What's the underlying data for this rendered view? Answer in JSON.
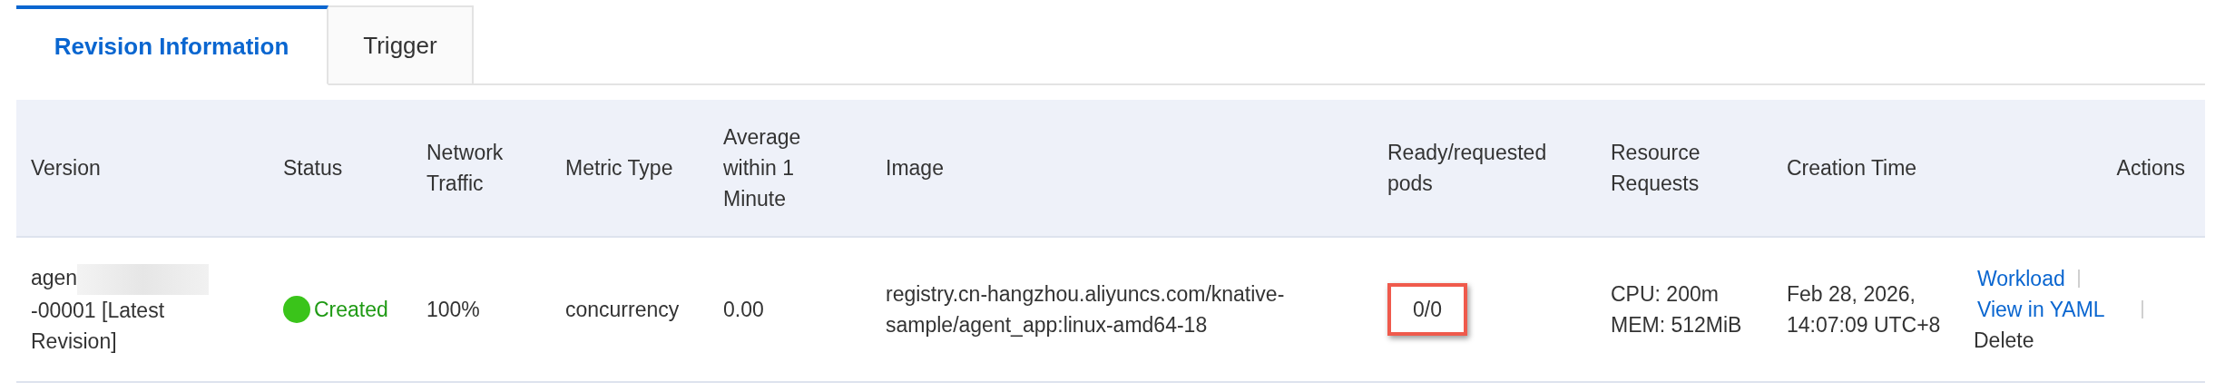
{
  "tabs": [
    {
      "label": "Revision Information",
      "selected": true
    },
    {
      "label": "Trigger",
      "selected": false
    }
  ],
  "table": {
    "columns": [
      "Version",
      "Status",
      "Network Traffic",
      "Metric Type",
      "Average within 1 Minute",
      "Image",
      "Ready/requested pods",
      "Resource Requests",
      "Creation Time",
      "Actions"
    ],
    "rows": [
      {
        "version_start": "agen",
        "version_redacted": true,
        "version_end": "-00001 [Latest Revision]",
        "status": {
          "label": "Created",
          "color": "#3ac41a"
        },
        "network_traffic": "100%",
        "metric_type": "concurrency",
        "average": "0.00",
        "image": "registry.cn-hangzhou.aliyuncs.com/knative-sample/agent_app:linux-amd64-18",
        "pods": {
          "value": "0/0",
          "highlighted": true
        },
        "resources": [
          "CPU: 200m",
          "MEM: 512MiB"
        ],
        "creation_time": "Feb 28, 2026, 14:07:09 UTC+8",
        "actions": [
          {
            "label": "Workload",
            "disabled": false
          },
          {
            "label": "View in YAML",
            "disabled": false
          },
          {
            "label": "Delete",
            "disabled": true
          }
        ]
      }
    ]
  }
}
